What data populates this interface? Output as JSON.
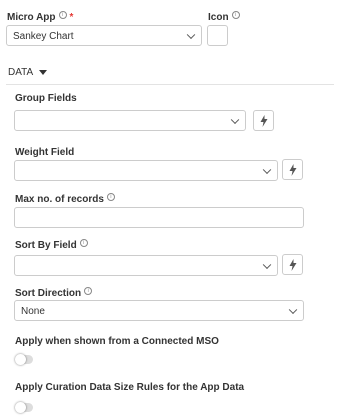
{
  "micro_app": {
    "label": "Micro App",
    "required_mark": "*",
    "value": "Sankey Chart"
  },
  "icon_field": {
    "label": "Icon"
  },
  "data_section": {
    "title": "DATA"
  },
  "group_fields": {
    "label": "Group Fields",
    "value": ""
  },
  "weight_field": {
    "label": "Weight Field",
    "value": ""
  },
  "max_records": {
    "label": "Max no. of records",
    "value": ""
  },
  "sort_by_field": {
    "label": "Sort By Field",
    "value": ""
  },
  "sort_direction": {
    "label": "Sort Direction",
    "value": "None"
  },
  "connected_mso_toggle": {
    "label": "Apply when shown from a Connected MSO",
    "on": false
  },
  "curation_toggle": {
    "label": "Apply Curation Data Size Rules for the App Data",
    "on": false
  },
  "info_glyph": "i"
}
